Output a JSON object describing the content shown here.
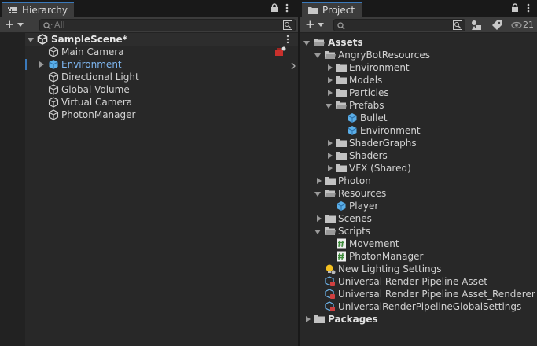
{
  "hierarchy": {
    "tab_label": "Hierarchy",
    "search_placeholder": "All",
    "scene_name": "SampleScene*",
    "items": [
      {
        "label": "Main Camera"
      },
      {
        "label": "Environment"
      },
      {
        "label": "Directional Light"
      },
      {
        "label": "Global Volume"
      },
      {
        "label": "Virtual Camera"
      },
      {
        "label": "PhotonManager"
      }
    ]
  },
  "project": {
    "tab_label": "Project",
    "hidden_count": "21",
    "tree": [
      {
        "label": "Assets"
      },
      {
        "label": "AngryBotResources"
      },
      {
        "label": "Environment"
      },
      {
        "label": "Models"
      },
      {
        "label": "Particles"
      },
      {
        "label": "Prefabs"
      },
      {
        "label": "Bullet"
      },
      {
        "label": "Environment"
      },
      {
        "label": "ShaderGraphs"
      },
      {
        "label": "Shaders"
      },
      {
        "label": "VFX (Shared)"
      },
      {
        "label": "Photon"
      },
      {
        "label": "Resources"
      },
      {
        "label": "Player"
      },
      {
        "label": "Scenes"
      },
      {
        "label": "Scripts"
      },
      {
        "label": "Movement"
      },
      {
        "label": "PhotonManager"
      },
      {
        "label": "New Lighting Settings"
      },
      {
        "label": "Universal Render Pipeline Asset"
      },
      {
        "label": "Universal Render Pipeline Asset_Renderer"
      },
      {
        "label": "UniversalRenderPipelineGlobalSettings"
      },
      {
        "label": "Packages"
      }
    ]
  },
  "colors": {
    "accent": "#3a79bb",
    "selected_text": "#7eb6f0",
    "folder": "#c2c2c2",
    "prefab": "#6fb8f0",
    "script": "#4e9a48"
  },
  "icons": [
    "list-icon",
    "folder-icon",
    "lock-icon",
    "menu-icon",
    "search-icon",
    "unity-scene-icon",
    "gameobject-icon",
    "prefab-icon",
    "script-icon",
    "lighting-icon",
    "pipeline-asset-icon",
    "eye-icon",
    "label-icon",
    "filter-icon"
  ]
}
